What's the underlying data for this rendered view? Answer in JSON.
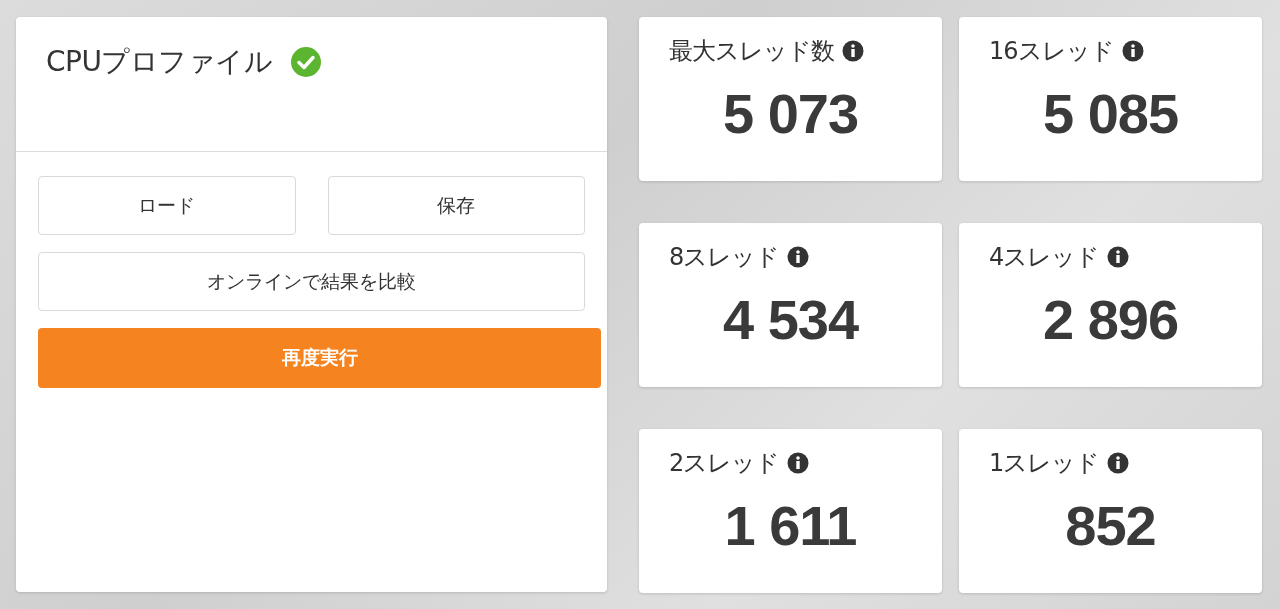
{
  "profile": {
    "title": "CPUプロファイル",
    "verified": true,
    "buttons": [
      {
        "label": "ロード",
        "kind": "secondary"
      },
      {
        "label": "保存",
        "kind": "secondary"
      },
      {
        "label": "オンラインで結果を比較",
        "kind": "wide"
      },
      {
        "label": "再度実行",
        "kind": "primary"
      }
    ]
  },
  "scores": [
    {
      "label": "最大スレッド数",
      "value": "5 073"
    },
    {
      "label": "16スレッド",
      "value": "5 085"
    },
    {
      "label": "8スレッド",
      "value": "4 534"
    },
    {
      "label": "4スレッド",
      "value": "2 896"
    },
    {
      "label": "2スレッド",
      "value": "1 611"
    },
    {
      "label": "1スレッド",
      "value": "852"
    }
  ]
}
